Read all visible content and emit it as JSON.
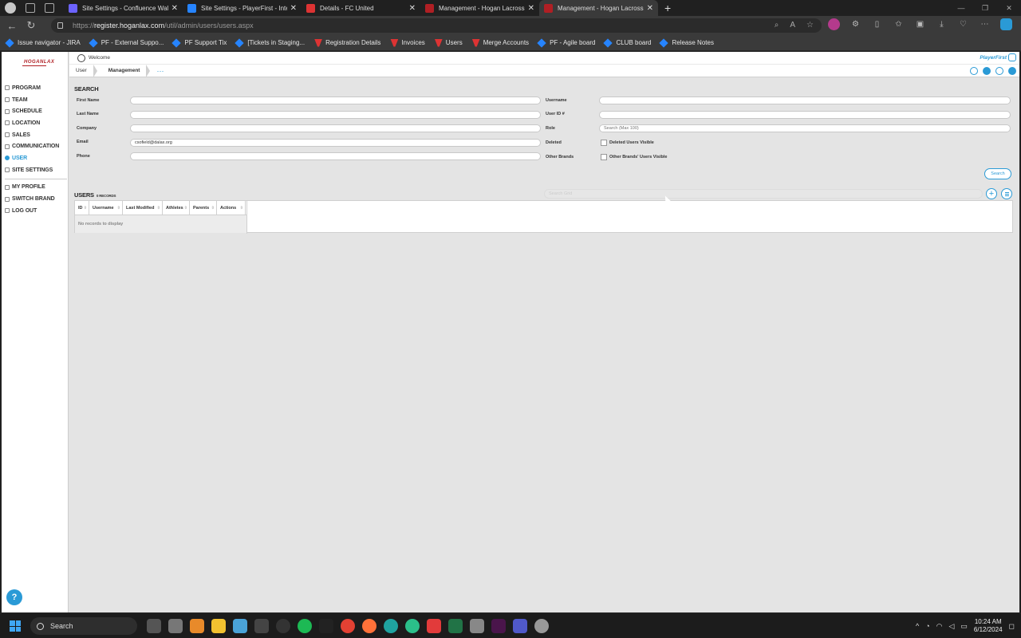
{
  "browser": {
    "tabs": [
      {
        "title": "Site Settings - Confluence Walk",
        "active": false,
        "favicon_color": "#6c63ff"
      },
      {
        "title": "Site Settings - PlayerFirst - Intern",
        "active": false,
        "favicon_color": "#2684ff"
      },
      {
        "title": "Details - FC United",
        "active": false,
        "favicon_color": "#d33"
      },
      {
        "title": "Management - Hogan Lacrosse",
        "active": false,
        "favicon_color": "#b01f24"
      },
      {
        "title": "Management - Hogan Lacrosse",
        "active": true,
        "favicon_color": "#b01f24"
      }
    ],
    "url_prefix": "https://",
    "url_host": "register.hoganlax.com",
    "url_path": "/util/admin/users/users.aspx",
    "bookmarks": [
      {
        "label": "Issue navigator - JIRA",
        "icon": "jira"
      },
      {
        "label": "PF - External Suppo...",
        "icon": "jira"
      },
      {
        "label": "PF Support Tix",
        "icon": "jira"
      },
      {
        "label": "[Tickets in Staging...",
        "icon": "jira"
      },
      {
        "label": "Registration Details",
        "icon": "pf"
      },
      {
        "label": "Invoices",
        "icon": "pf"
      },
      {
        "label": "Users",
        "icon": "pf"
      },
      {
        "label": "Merge Accounts",
        "icon": "pf"
      },
      {
        "label": "PF - Agile board",
        "icon": "jira"
      },
      {
        "label": "CLUB board",
        "icon": "jira"
      },
      {
        "label": "Release Notes",
        "icon": "jira"
      }
    ]
  },
  "app": {
    "logo_text": "HOGANLAX",
    "brand_text": "PlayerFirst",
    "welcome": "Welcome",
    "breadcrumb": [
      "User",
      "Management"
    ],
    "breadcrumb_more": "···",
    "nav": [
      {
        "label": "Program",
        "active": false
      },
      {
        "label": "Team",
        "active": false
      },
      {
        "label": "Schedule",
        "active": false
      },
      {
        "label": "Location",
        "active": false
      },
      {
        "label": "Sales",
        "active": false
      },
      {
        "label": "Communication",
        "active": false
      },
      {
        "label": "User",
        "active": true
      },
      {
        "label": "Site Settings",
        "active": false
      }
    ],
    "nav_secondary": [
      {
        "label": "My Profile"
      },
      {
        "label": "Switch Brand"
      },
      {
        "label": "Log Out"
      }
    ],
    "help": "?"
  },
  "search": {
    "title": "Search",
    "first_name": {
      "label": "First Name",
      "value": ""
    },
    "last_name": {
      "label": "Last Name",
      "value": ""
    },
    "company": {
      "label": "Company",
      "value": ""
    },
    "email": {
      "label": "Email",
      "value": "csofield@dalax.org"
    },
    "phone": {
      "label": "Phone",
      "value": ""
    },
    "username": {
      "label": "Username",
      "value": ""
    },
    "user_id": {
      "label": "User ID #",
      "value": ""
    },
    "role": {
      "label": "Role",
      "placeholder": "Search (Max 100)"
    },
    "deleted": {
      "label": "Deleted",
      "checkbox": "Deleted Users Visible"
    },
    "other_brands": {
      "label": "Other Brands",
      "checkbox": "Other Brands' Users Visible"
    },
    "button": "Search"
  },
  "users": {
    "title": "Users",
    "count": "0 records",
    "search_placeholder": "Search Grid",
    "columns": [
      "ID",
      "Username",
      "Last Modified",
      "Athletes",
      "Parents",
      "Actions"
    ],
    "empty": "No records to display"
  },
  "taskbar": {
    "search": "Search",
    "time": "10:24 AM",
    "date": "6/12/2024"
  }
}
